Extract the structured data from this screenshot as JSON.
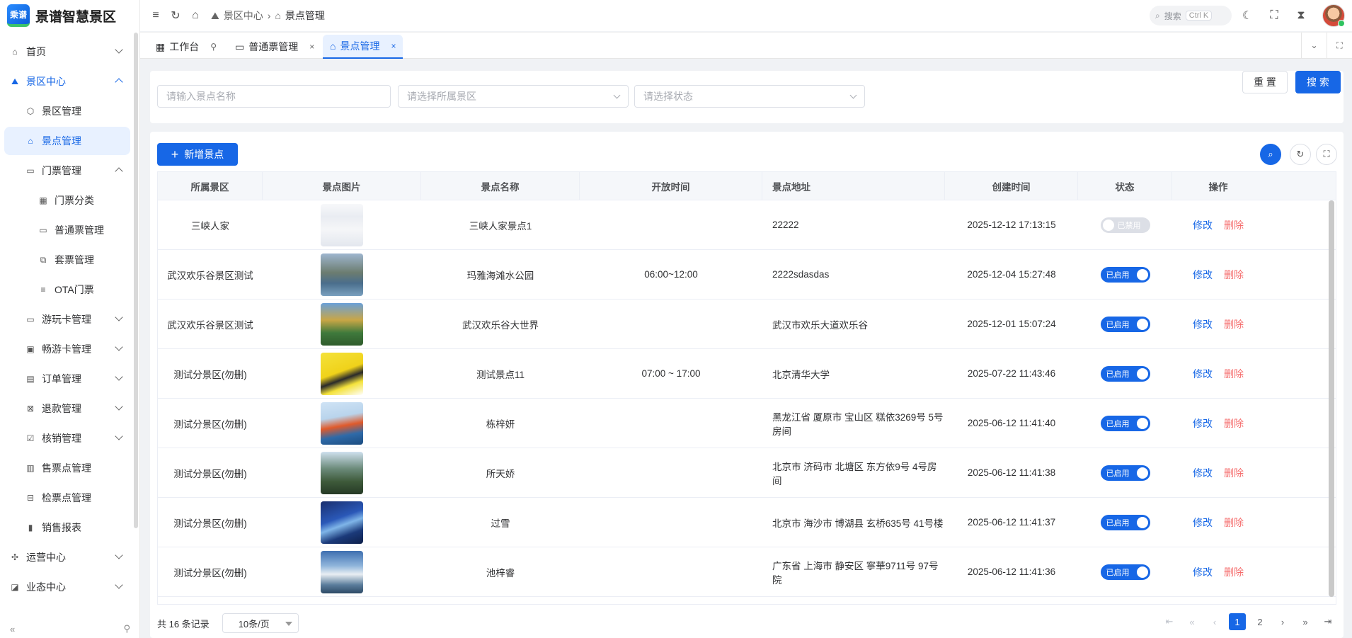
{
  "app": {
    "logo_text": "乘谱",
    "title": "景谱智慧景区"
  },
  "sidebar": {
    "items": [
      {
        "label": "首页",
        "icon": "home-icon",
        "glyph": "⌂",
        "level": 0,
        "arrow": "down",
        "state": ""
      },
      {
        "label": "景区中心",
        "icon": "mountain-icon",
        "glyph": "⛰",
        "level": 0,
        "arrow": "up",
        "state": "open-parent"
      },
      {
        "label": "景区管理",
        "icon": "hexagon-icon",
        "glyph": "⬡",
        "level": 1,
        "arrow": "",
        "state": ""
      },
      {
        "label": "景点管理",
        "icon": "building-icon",
        "glyph": "⌂",
        "level": 1,
        "arrow": "",
        "state": "active"
      },
      {
        "label": "门票管理",
        "icon": "ticket-icon",
        "glyph": "▭",
        "level": 1,
        "arrow": "up",
        "state": ""
      },
      {
        "label": "门票分类",
        "icon": "grid-icon",
        "glyph": "▦",
        "level": 2,
        "arrow": "",
        "state": ""
      },
      {
        "label": "普通票管理",
        "icon": "ticket-icon",
        "glyph": "▭",
        "level": 2,
        "arrow": "",
        "state": ""
      },
      {
        "label": "套票管理",
        "icon": "package-icon",
        "glyph": "⧉",
        "level": 2,
        "arrow": "",
        "state": ""
      },
      {
        "label": "OTA门票",
        "icon": "list-icon",
        "glyph": "≡",
        "level": 2,
        "arrow": "",
        "state": ""
      },
      {
        "label": "游玩卡管理",
        "icon": "card-icon",
        "glyph": "▭",
        "level": 1,
        "arrow": "down",
        "state": ""
      },
      {
        "label": "畅游卡管理",
        "icon": "card-icon",
        "glyph": "▣",
        "level": 1,
        "arrow": "down",
        "state": ""
      },
      {
        "label": "订单管理",
        "icon": "document-icon",
        "glyph": "▤",
        "level": 1,
        "arrow": "down",
        "state": ""
      },
      {
        "label": "退款管理",
        "icon": "refund-icon",
        "glyph": "⊠",
        "level": 1,
        "arrow": "down",
        "state": ""
      },
      {
        "label": "核销管理",
        "icon": "verify-icon",
        "glyph": "☑",
        "level": 1,
        "arrow": "down",
        "state": ""
      },
      {
        "label": "售票点管理",
        "icon": "shop-icon",
        "glyph": "▥",
        "level": 1,
        "arrow": "",
        "state": ""
      },
      {
        "label": "检票点管理",
        "icon": "gate-icon",
        "glyph": "⊟",
        "level": 1,
        "arrow": "",
        "state": ""
      },
      {
        "label": "销售报表",
        "icon": "chart-icon",
        "glyph": "▮",
        "level": 1,
        "arrow": "",
        "state": ""
      },
      {
        "label": "运营中心",
        "icon": "puzzle-icon",
        "glyph": "✣",
        "level": 0,
        "arrow": "down",
        "state": ""
      },
      {
        "label": "业态中心",
        "icon": "store-icon",
        "glyph": "◪",
        "level": 0,
        "arrow": "down",
        "state": ""
      }
    ]
  },
  "topbar": {
    "breadcrumb": [
      "景区中心",
      "景点管理"
    ],
    "search_label": "搜索",
    "search_kbd": "Ctrl K"
  },
  "tabs": [
    {
      "label": "工作台",
      "icon": "dashboard-icon",
      "glyph": "▦",
      "suffix": "⚲",
      "active": false
    },
    {
      "label": "普通票管理",
      "icon": "ticket-icon",
      "glyph": "▭",
      "suffix": "×",
      "active": false
    },
    {
      "label": "景点管理",
      "icon": "building-icon",
      "glyph": "⌂",
      "suffix": "×",
      "active": true
    }
  ],
  "filter": {
    "name_placeholder": "请输入景点名称",
    "area_placeholder": "请选择所属景区",
    "status_placeholder": "请选择状态",
    "reset_label": "重 置",
    "search_label": "搜 索"
  },
  "toolbar": {
    "add_label": "新增景点"
  },
  "table": {
    "columns": [
      "所属景区",
      "景点图片",
      "景点名称",
      "开放时间",
      "景点地址",
      "创建时间",
      "状态",
      "操作"
    ],
    "edit_label": "修改",
    "delete_label": "删除",
    "rows": [
      {
        "area": "三峡人家",
        "name": "三峡人家景点1",
        "hours": "",
        "address": "22222",
        "created": "2025-12-12 17:13:15",
        "status": "已禁用",
        "enabled": false,
        "img": "linear-gradient(180deg,#f7f8fa 0%,#e9ecf2 30%,#f5f6f8 60%,#e3e7ee 100%)"
      },
      {
        "area": "武汉欢乐谷景区测试",
        "name": "玛雅海滩水公园",
        "hours": "06:00~12:00",
        "address": "2222sdasdas",
        "created": "2025-12-04 15:27:48",
        "status": "已启用",
        "enabled": true,
        "img": "linear-gradient(180deg,#9fb6cf 0%,#6c7d70 45%,#4a6e8c 70%,#7aa0bf 100%)"
      },
      {
        "area": "武汉欢乐谷景区测试",
        "name": "武汉欢乐谷大世界",
        "hours": "",
        "address": "武汉市欢乐大道欢乐谷",
        "created": "2025-12-01 15:07:24",
        "status": "已启用",
        "enabled": true,
        "img": "linear-gradient(180deg,#6aa0d8 0%,#c9a646 40%,#3f7a3c 70%,#2f5b2c 100%)"
      },
      {
        "area": "测试分景区(勿删)",
        "name": "测试景点11",
        "hours": "07:00 ~ 17:00",
        "address": "北京清华大学",
        "created": "2025-07-22 11:43:46",
        "status": "已启用",
        "enabled": true,
        "img": "linear-gradient(160deg,#f4e23a 0%,#f0d21a 45%,#2a2a2a 60%,#f4e23a 75%,#ffffff 100%)"
      },
      {
        "area": "测试分景区(勿删)",
        "name": "栋梓妍",
        "hours": "",
        "address": "黑龙江省 厦原市 宝山区 糕依3269号 5号房间",
        "created": "2025-06-12 11:41:40",
        "status": "已启用",
        "enabled": true,
        "img": "linear-gradient(170deg,#cfe3f5 0%,#b9d4ec 35%,#e05a2b 55%,#2f6aa8 75%,#1b4c80 100%)"
      },
      {
        "area": "测试分景区(勿删)",
        "name": "所天娇",
        "hours": "",
        "address": "北京市 济码市 北塘区 东方依9号 4号房间",
        "created": "2025-06-12 11:41:38",
        "status": "已启用",
        "enabled": true,
        "img": "linear-gradient(180deg,#cfe0ee 0%,#6b8a7a 40%,#3e5a3a 70%,#263a26 100%)"
      },
      {
        "area": "测试分景区(勿删)",
        "name": "过雪",
        "hours": "",
        "address": "北京市 海沙市 博湖县 玄桥635号 41号楼",
        "created": "2025-06-12 11:41:37",
        "status": "已启用",
        "enabled": true,
        "img": "linear-gradient(160deg,#1a2f6e 0%,#2a58b8 40%,#7fb5e8 55%,#1b3a7a 75%,#0d1f4a 100%)"
      },
      {
        "area": "测试分景区(勿删)",
        "name": "池梓睿",
        "hours": "",
        "address": "广东省 上海市 静安区 寧華9711号 97号院",
        "created": "2025-06-12 11:41:36",
        "status": "已启用",
        "enabled": true,
        "img": "linear-gradient(180deg,#3e6fb0 0%,#8fb5db 35%,#e9eef3 55%,#5b7d9c 80%,#2d4a66 100%)"
      }
    ]
  },
  "pager": {
    "total": "共 16 条记录",
    "page_size": "10条/页",
    "pages": [
      "1",
      "2"
    ],
    "current": "1"
  }
}
